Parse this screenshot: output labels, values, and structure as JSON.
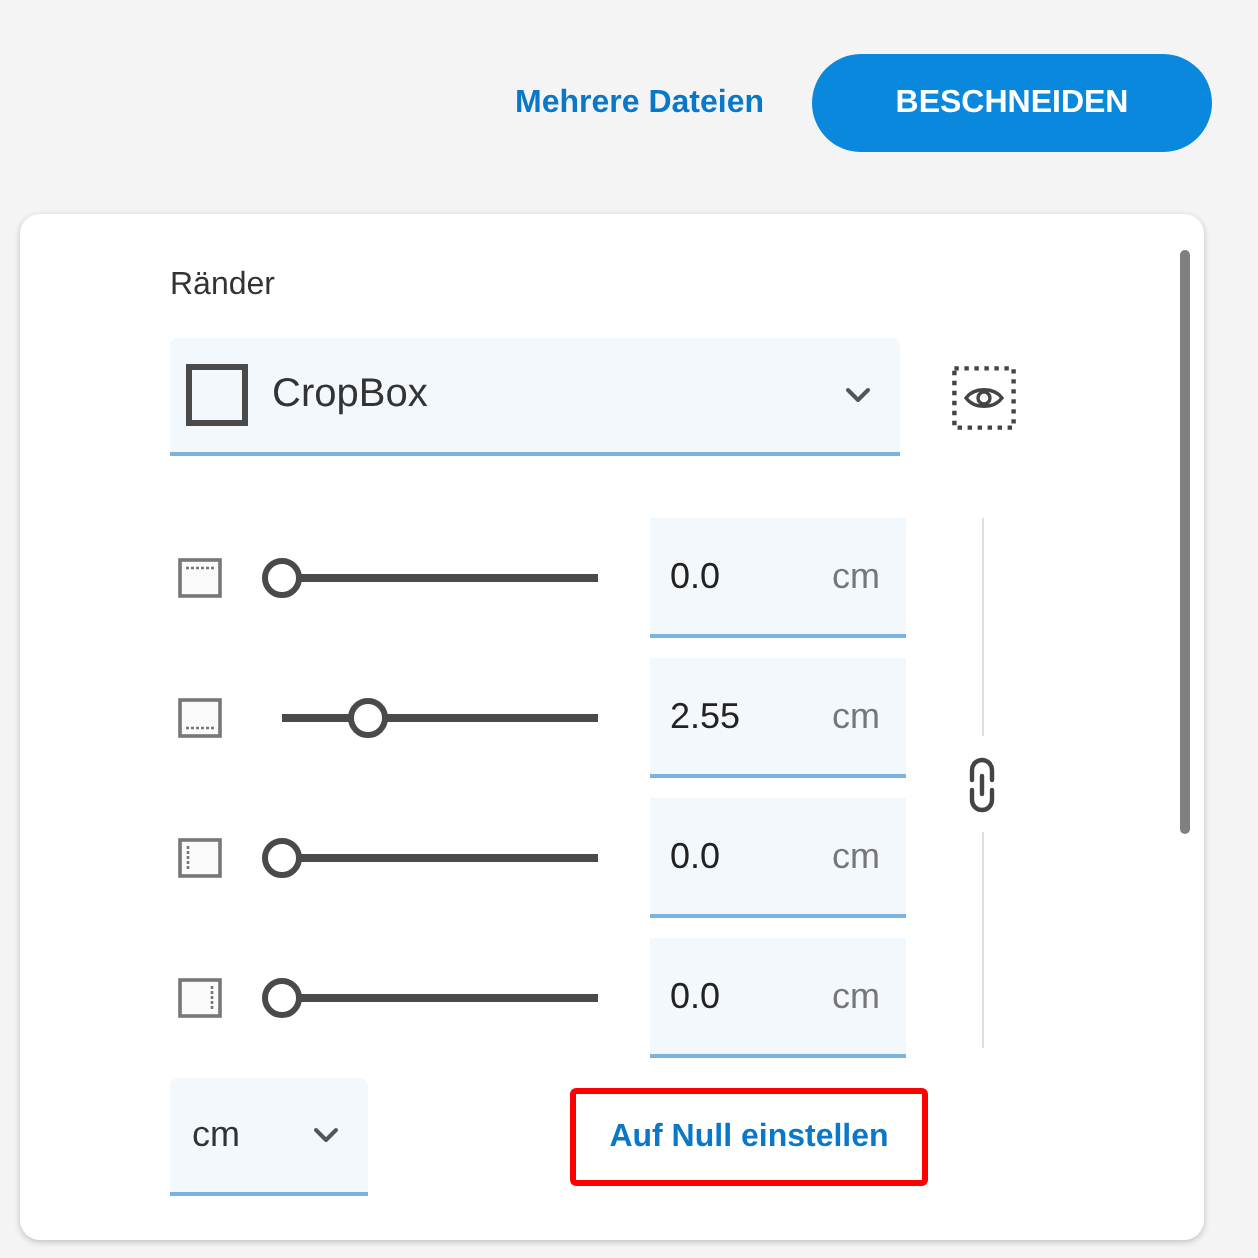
{
  "header": {
    "multiple_files_link": "Mehrere Dateien",
    "crop_button": "BESCHNEIDEN"
  },
  "panel": {
    "title": "Ränder",
    "box_select": "CropBox",
    "margins": [
      {
        "kind": "top",
        "level": 0,
        "value": "0.0",
        "unit": "cm"
      },
      {
        "kind": "bottom",
        "level": 0.27,
        "value": "2.55",
        "unit": "cm"
      },
      {
        "kind": "left",
        "level": 0,
        "value": "0.0",
        "unit": "cm"
      },
      {
        "kind": "right",
        "level": 0,
        "value": "0.0",
        "unit": "cm"
      }
    ],
    "unit_select": "cm",
    "reset_link": {
      "label": "Auf Null einstellen",
      "highlighted": true
    }
  }
}
